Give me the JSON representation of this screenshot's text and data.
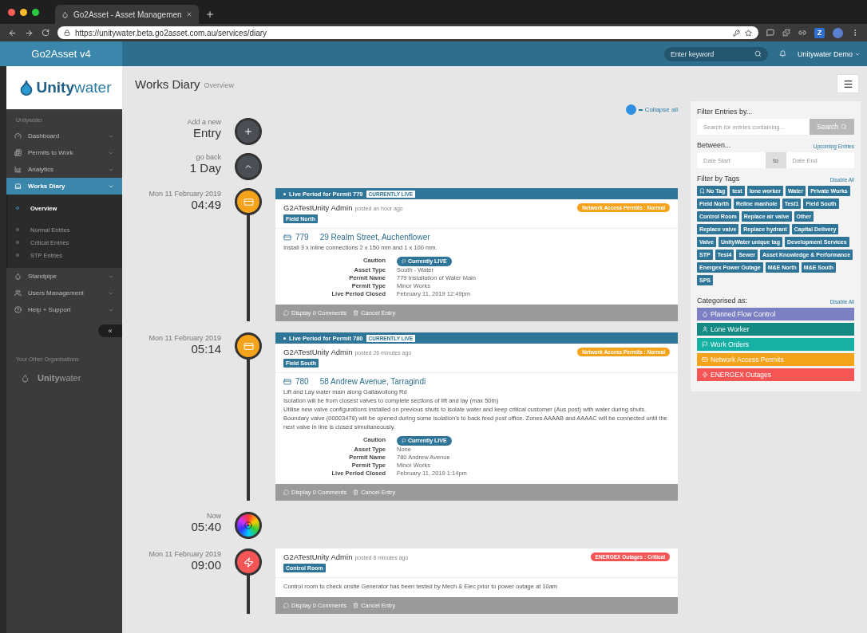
{
  "browser": {
    "tab_title": "Go2Asset - Asset Managemen",
    "url": "https://unitywater.beta.go2asset.com.au/services/diary",
    "extension_letter": "Z"
  },
  "header": {
    "brand": "Go2Asset v4",
    "search_placeholder": "Enter keyword",
    "user": "Unitywater Demo"
  },
  "sidebar": {
    "logo": "**Unity**water",
    "org_label": "Unitywater",
    "items": [
      {
        "label": "Dashboard",
        "selected": false,
        "expanded": false
      },
      {
        "label": "Permits to Work",
        "selected": false,
        "expanded": false
      },
      {
        "label": "Analytics",
        "selected": false,
        "expanded": false
      },
      {
        "label": "Works Diary",
        "selected": true,
        "expanded": true,
        "children": [
          {
            "label": "Overview",
            "selected": true
          },
          {
            "label": "Normal Entries",
            "selected": false
          },
          {
            "label": "Critical Entries",
            "selected": false
          },
          {
            "label": "STP Entries",
            "selected": false
          }
        ]
      },
      {
        "label": "Standpipe",
        "selected": false,
        "expanded": false
      },
      {
        "label": "Users Management",
        "selected": false,
        "expanded": false
      },
      {
        "label": "Help + Support",
        "selected": false,
        "expanded": false
      }
    ],
    "collapse": "«",
    "other_label": "Your Other Organisations",
    "other_org": "**Unity**water"
  },
  "page": {
    "title": "Works Diary",
    "subtitle": "Overview",
    "collapse_all": "Collapse all"
  },
  "timeline": [
    {
      "kind": "add",
      "small": "Add a new",
      "big": "Entry"
    },
    {
      "kind": "back",
      "small": "go back",
      "big": "1 Day"
    },
    {
      "kind": "permit",
      "small": "Mon 11 February 2019",
      "big": "04:49",
      "color": "#f5a31b",
      "banner": "Live Period for Permit 779",
      "banner_badge": "CURRENTLY LIVE",
      "author": "G2ATestUnity Admin",
      "posted": "posted an hour ago",
      "tag": "Field North",
      "category": "Network Access Permits : Normal",
      "permit": "779",
      "address": "29 Realm Street, Auchenflower",
      "description": [
        "Install 3 x inline connections 2 x 150 mm and 1 x 100 mm."
      ],
      "details": [
        {
          "label": "Caution",
          "value": "Currently LIVE",
          "kind": "badge"
        },
        {
          "label": "Asset Type",
          "value": "South - Water",
          "kind": "text"
        },
        {
          "label": "Permit Name",
          "value": "779 Installation of Water Main",
          "kind": "text"
        },
        {
          "label": "Permit Type",
          "value": "Minor Works",
          "kind": "text"
        },
        {
          "label": "Live Period Closed",
          "value": "February 11, 2019 12:49pm",
          "kind": "text"
        }
      ],
      "actions": [
        "Display 0 Comments",
        "Cancel Entry"
      ]
    },
    {
      "kind": "permit",
      "small": "Mon 11 February 2019",
      "big": "05:14",
      "color": "#f5a31b",
      "banner": "Live Period for Permit 780",
      "banner_badge": "CURRENTLY LIVE",
      "author": "G2ATestUnity Admin",
      "posted": "posted 26 minutes ago",
      "tag": "Field South",
      "category": "Network Access Permits : Normal",
      "permit": "780",
      "address": "58 Andrew Avenue, Tarragindi",
      "description": [
        "Lift and Lay water main along Gallawollong Rd",
        "Isolation will be from closest valves to complete sections of lift and lay (max 50m)",
        "Utilise new valve configurations installed on previous shuts to isolate water and keep critical customer (Aus post) with water during shuts. Boundary valve (00003478) will be opened during some isolation's to back feed post office. Zones AAAAB and AAAAC will be connected until the next valve in line is closed simultaneously."
      ],
      "details": [
        {
          "label": "Caution",
          "value": "Currently LIVE",
          "kind": "badge"
        },
        {
          "label": "Asset Type",
          "value": "None",
          "kind": "text"
        },
        {
          "label": "Permit Name",
          "value": "780 Andrew Avenue",
          "kind": "text"
        },
        {
          "label": "Permit Type",
          "value": "Minor Works",
          "kind": "text"
        },
        {
          "label": "Live Period Closed",
          "value": "February 11, 2019 1:14pm",
          "kind": "text"
        }
      ],
      "actions": [
        "Display 0 Comments",
        "Cancel Entry"
      ]
    },
    {
      "kind": "now",
      "small": "Now",
      "big": "05:40"
    },
    {
      "kind": "outage",
      "small": "Mon 11 February 2019",
      "big": "09:00",
      "color": "#f55555",
      "author": "G2ATestUnity Admin",
      "posted": "posted 8 minutes ago",
      "tag": "Control Room",
      "category": "ENERGEX Outages : Critical",
      "description": [
        "Control room to check onsite Generator has been tested by Mech & Elec prior to power outage at 10am"
      ],
      "actions": [
        "Display 0 Comments",
        "Cancel Entry"
      ]
    }
  ],
  "filters": {
    "title": "Filter Entries by...",
    "search_placeholder": "Search for entries containing...",
    "search_button": "Search",
    "between": "Between...",
    "upcoming": "Upcoming Entries",
    "date_start": "Date Start",
    "to": "to",
    "date_end": "Date End",
    "tags_title": "Filter by Tags",
    "tags_disable": "Disable All",
    "tags": [
      {
        "label": "No Tag",
        "kind": "none"
      },
      {
        "label": "test",
        "kind": "tag"
      },
      {
        "label": "lone worker",
        "kind": "tag"
      },
      {
        "label": "Water",
        "kind": "tag"
      },
      {
        "label": "Private Works",
        "kind": "tag"
      },
      {
        "label": "Field North",
        "kind": "tag"
      },
      {
        "label": "Reline manhole",
        "kind": "tag"
      },
      {
        "label": "Test1",
        "kind": "tag"
      },
      {
        "label": "Field South",
        "kind": "tag"
      },
      {
        "label": "Control Room",
        "kind": "tag"
      },
      {
        "label": "Replace air valve",
        "kind": "tag"
      },
      {
        "label": "Other",
        "kind": "tag"
      },
      {
        "label": "Replace valve",
        "kind": "tag"
      },
      {
        "label": "Replace hydrant",
        "kind": "tag"
      },
      {
        "label": "Capital Delivery",
        "kind": "tag"
      },
      {
        "label": "Valve",
        "kind": "tag"
      },
      {
        "label": "UnityWater unique tag",
        "kind": "tag"
      },
      {
        "label": "Development Services",
        "kind": "tag"
      },
      {
        "label": "STP",
        "kind": "tag"
      },
      {
        "label": "Test4",
        "kind": "tag"
      },
      {
        "label": "Sewer",
        "kind": "tag"
      },
      {
        "label": "Asset Knowledge & Performance",
        "kind": "tag"
      },
      {
        "label": "Energex Power Outage",
        "kind": "tag"
      },
      {
        "label": "M&E North",
        "kind": "tag"
      },
      {
        "label": "M&E South",
        "kind": "tag"
      },
      {
        "label": "SPS",
        "kind": "tag"
      }
    ],
    "categories_title": "Categorised as:",
    "categories_disable": "Disable All",
    "categories": [
      {
        "label": "Planned Flow Control",
        "color": "#7b7fc4"
      },
      {
        "label": "Lone Worker",
        "color": "#148a84"
      },
      {
        "label": "Work Orders",
        "color": "#17b0a5"
      },
      {
        "label": "Network Access Permits",
        "color": "#f5a31b"
      },
      {
        "label": "ENERGEX Outages",
        "color": "#f55555"
      }
    ]
  }
}
